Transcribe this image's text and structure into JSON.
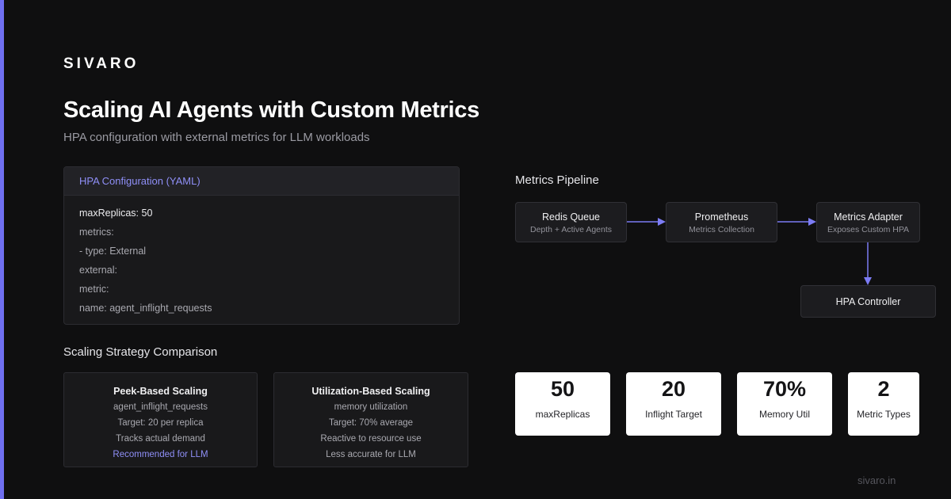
{
  "brand": {
    "logo": "SIVARO",
    "footer_url": "sivaro.in",
    "accent": "#6f6ff0"
  },
  "header": {
    "title": "Scaling AI Agents with Custom Metrics",
    "subtitle": "HPA configuration with external metrics for LLM workloads"
  },
  "yaml_card": {
    "title": "HPA Configuration (YAML)",
    "lines": [
      "maxReplicas: 50",
      "metrics:",
      "- type: External",
      "external:",
      "metric:",
      "name: agent_inflight_requests"
    ]
  },
  "comparison": {
    "title": "Scaling Strategy Comparison",
    "cards": [
      {
        "title": "Peek-Based Scaling",
        "lines": [
          "agent_inflight_requests",
          "Target: 20 per replica",
          "Tracks actual demand",
          "Recommended for LLM"
        ]
      },
      {
        "title": "Utilization-Based Scaling",
        "lines": [
          "memory utilization",
          "Target: 70% average",
          "Reactive to resource use",
          "Less accurate for LLM"
        ]
      }
    ]
  },
  "pipeline": {
    "title": "Metrics Pipeline",
    "nodes": [
      {
        "title": "Redis Queue",
        "subtitle": "Depth + Active Agents"
      },
      {
        "title": "Prometheus",
        "subtitle": "Metrics Collection"
      },
      {
        "title": "Metrics Adapter",
        "subtitle": "Exposes Custom HPA"
      },
      {
        "title": "HPA Controller"
      }
    ],
    "arrow_color": "#7c7cf4"
  },
  "stats": [
    {
      "value": "50",
      "label": "maxReplicas"
    },
    {
      "value": "20",
      "label": "Inflight Target"
    },
    {
      "value": "70%",
      "label": "Memory Util"
    },
    {
      "value": "2",
      "label": "Metric Types"
    }
  ]
}
